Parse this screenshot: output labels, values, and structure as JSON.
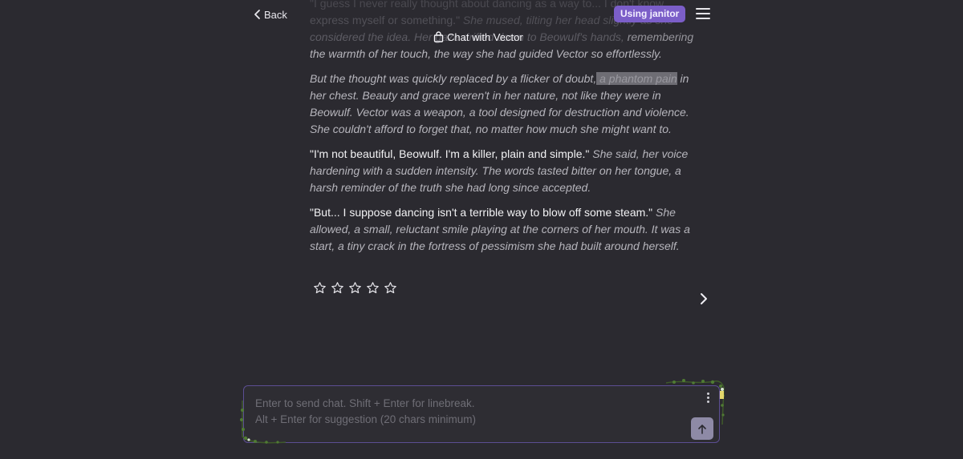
{
  "header": {
    "back_label": "Back",
    "title": "Chat with Vector",
    "badge": "Using janitor",
    "accent_color": "#7b5ec8"
  },
  "message": {
    "paragraphs": [
      {
        "parts": [
          {
            "type": "speech",
            "faded": true,
            "text": "\"I guess I never really thought about dancing as a way to... I don't know, express myself or something.\""
          },
          {
            "type": "narr",
            "faded": true,
            "text": " She mused, tilting her head slightly as she considered the idea. Her gaze drifted down to Beowulf's hands,"
          },
          {
            "type": "narr",
            "faded": false,
            "text": " remembering the warmth of her touch, the way she had guided Vector so effortlessly."
          }
        ]
      },
      {
        "parts": [
          {
            "type": "narr",
            "text": "But the thought was quickly replaced by a flicker of doubt,"
          },
          {
            "type": "highlight",
            "text": " a phantom pain"
          },
          {
            "type": "narr",
            "text": " in her chest. Beauty and grace weren't in her nature, not like they were in Beowulf. Vector was a weapon, a tool designed for destruction and violence. She couldn't afford to forget that, no matter how much she might want to."
          }
        ]
      },
      {
        "parts": [
          {
            "type": "speech",
            "text": "\"I'm not beautiful, Beowulf. I'm a killer, plain and simple.\""
          },
          {
            "type": "narr",
            "text": " She said, her voice hardening with a sudden intensity. The words tasted bitter on her tongue, a harsh reminder of the truth she had long since accepted."
          }
        ]
      },
      {
        "parts": [
          {
            "type": "speech",
            "text": "\"But... I suppose dancing isn't a terrible way to blow off some steam.\""
          },
          {
            "type": "narr",
            "text": " She allowed, a small, reluctant smile playing at the corners of her mouth. It was a start, a tiny crack in the fortress of pessimism she had built around herself."
          }
        ]
      }
    ]
  },
  "rating": {
    "stars_total": 5,
    "stars_filled": 0
  },
  "composer": {
    "value": "",
    "placeholder": "Enter to send chat. Shift + Enter for linebreak.\nAlt + Enter for suggestion (20 chars minimum)",
    "border_color": "#5c4e93",
    "send_color": "#8e8aa6"
  },
  "icons": {
    "back": "chevron-left-icon",
    "title": "bag-icon",
    "menu": "hamburger-menu-icon",
    "star": "star-outline-icon",
    "next": "chevron-right-icon",
    "options": "vertical-dots-icon",
    "send": "arrow-up-icon"
  }
}
